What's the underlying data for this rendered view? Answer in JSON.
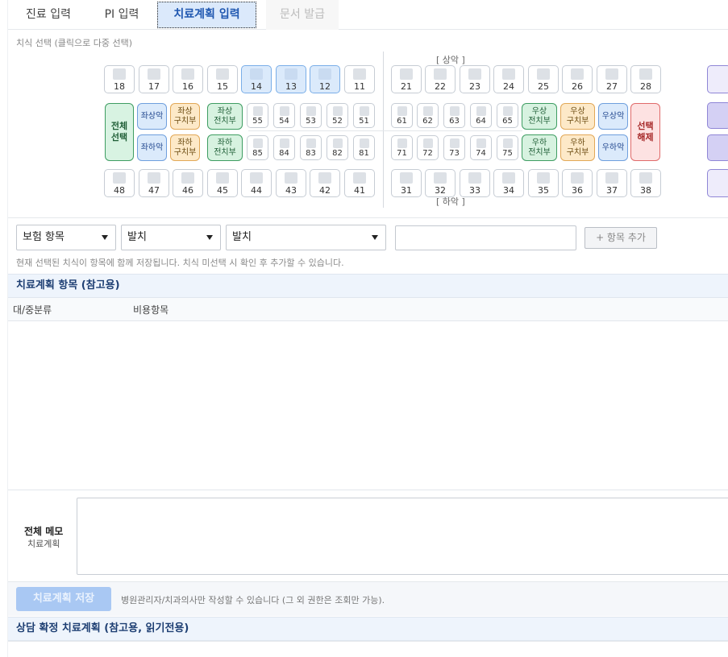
{
  "tabs": [
    {
      "label": "진료 입력"
    },
    {
      "label": "PI 입력"
    },
    {
      "label": "치료계획 입력"
    },
    {
      "label": "문서 발급"
    }
  ],
  "tooth_selector": {
    "caption": "치식 선택 (클릭으로 다중 선택)",
    "upper_label": "[ 상악 ]",
    "lower_label": "[ 하악 ]",
    "upper_permanent": [
      "18",
      "17",
      "16",
      "15",
      "14",
      "13",
      "12",
      "11",
      "21",
      "22",
      "23",
      "24",
      "25",
      "26",
      "27",
      "28"
    ],
    "upper_primary": [
      "55",
      "54",
      "53",
      "52",
      "51",
      "61",
      "62",
      "63",
      "64",
      "65"
    ],
    "lower_primary": [
      "85",
      "84",
      "83",
      "82",
      "81",
      "71",
      "72",
      "73",
      "74",
      "75"
    ],
    "lower_permanent": [
      "48",
      "47",
      "46",
      "45",
      "44",
      "43",
      "42",
      "41",
      "31",
      "32",
      "33",
      "34",
      "35",
      "36",
      "37",
      "38"
    ],
    "selected_teeth": [
      "14",
      "13",
      "12"
    ],
    "select_all": [
      "전체",
      "선택"
    ],
    "clear_selection": [
      "선택",
      "해제"
    ],
    "quick": {
      "upper_left": "좌상악",
      "upper_left_posterior": [
        "좌상",
        "구치부"
      ],
      "upper_left_anterior": [
        "좌상",
        "전치부"
      ],
      "lower_left": "좌하악",
      "lower_left_posterior": [
        "좌하",
        "구치부"
      ],
      "lower_left_anterior": [
        "좌하",
        "전치부"
      ],
      "upper_right_anterior": [
        "우상",
        "전치부"
      ],
      "upper_right_posterior": [
        "우상",
        "구치부"
      ],
      "upper_right": "우상악",
      "lower_right_anterior": [
        "우하",
        "전치부"
      ],
      "lower_right_posterior": [
        "우하",
        "구치부"
      ],
      "lower_right": "우하악"
    }
  },
  "item_entry": {
    "category_select": "보험 항목",
    "subcategory_select": "발치",
    "item_select": "발치",
    "memo_input_value": "",
    "add_button": "+ 항목 추가",
    "note": "현재 선택된 치식이 항목에 함께 저장됩니다. 치식 미선택 시 확인 후 추가할 수 있습니다."
  },
  "plan_table": {
    "title": "치료계획 항목 (참고용)",
    "columns": [
      "대/중분류",
      "비용항목"
    ]
  },
  "memo": {
    "title": "전체 메모",
    "subtitle": "치료계획",
    "value": ""
  },
  "footer": {
    "save_button": "치료계획 저장",
    "save_note": "병원관리자/치과의사만 작성할 수 있습니다 (그 외 권한은 조회만 가능)."
  },
  "consult_section": {
    "title": "상담 확정 치료계획 (참고용, 읽기전용)"
  }
}
